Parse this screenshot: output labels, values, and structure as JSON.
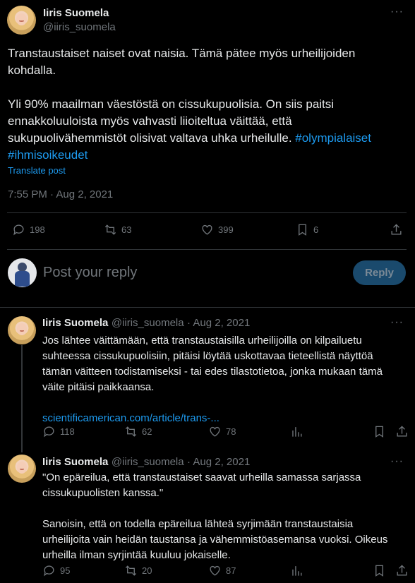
{
  "main_post": {
    "author_name": "Iiris Suomela",
    "author_handle": "@iiris_suomela",
    "text_line1": "Transtaustaiset naiset ovat naisia. Tämä pätee myös urheilijoiden",
    "text_line2": "kohdalla.",
    "text_line3": "Yli 90% maailman väestöstä on cissukupuolisia. On siis paitsi",
    "text_line4": "ennakkoluuloista myös vahvasti liioiteltua väittää, että",
    "text_line5_plain": "sukupuolivähemmistöt olisivat valtava uhka urheilulle. ",
    "hashtag1": "#olympialaiset",
    "hashtag2": "#ihmisoikeudet",
    "translate": "Translate post",
    "timestamp": "7:55 PM · Aug 2, 2021",
    "replies": "198",
    "reposts": "63",
    "likes": "399",
    "bookmarks": "6"
  },
  "composer": {
    "placeholder": "Post your reply",
    "button": "Reply"
  },
  "replies": [
    {
      "author_name": "Iiris Suomela",
      "author_handle": "@iiris_suomela",
      "date": "· Aug 2, 2021",
      "lines": [
        "Jos lähtee väittämään, että transtaustaisilla urheilijoilla on kilpailuetu",
        "suhteessa cissukupuolisiin, pitäisi löytää uskottavaa tieteellistä näyttöä",
        "tämän väitteen todistamiseksi - tai edes tilastotietoa, jonka mukaan tämä",
        "väite pitäisi paikkaansa."
      ],
      "link": "scientificamerican.com/article/trans-...",
      "replies": "118",
      "reposts": "62",
      "likes": "78"
    },
    {
      "author_name": "Iiris Suomela",
      "author_handle": "@iiris_suomela",
      "date": "· Aug 2, 2021",
      "lines": [
        "\"On epäreilua, että transtaustaiset saavat urheilla samassa sarjassa",
        "cissukupuolisten kanssa.\"",
        "Sanoisin, että on todella epäreilua lähteä syrjimään transtaustaisia",
        "urheilijoita vain heidän taustansa ja vähemmistöasemansa vuoksi. Oikeus",
        "urheilla ilman syrjintää kuuluu jokaiselle."
      ],
      "replies": "95",
      "reposts": "20",
      "likes": "87"
    }
  ],
  "icons": {
    "more": "more-icon",
    "reply": "reply-icon",
    "repost": "repost-icon",
    "like": "heart-icon",
    "views": "views-icon",
    "bookmark": "bookmark-icon",
    "share": "share-icon"
  },
  "colors": {
    "background": "#000000",
    "link": "#1d9bf0",
    "muted": "#71767b",
    "divider": "#2f3336"
  }
}
